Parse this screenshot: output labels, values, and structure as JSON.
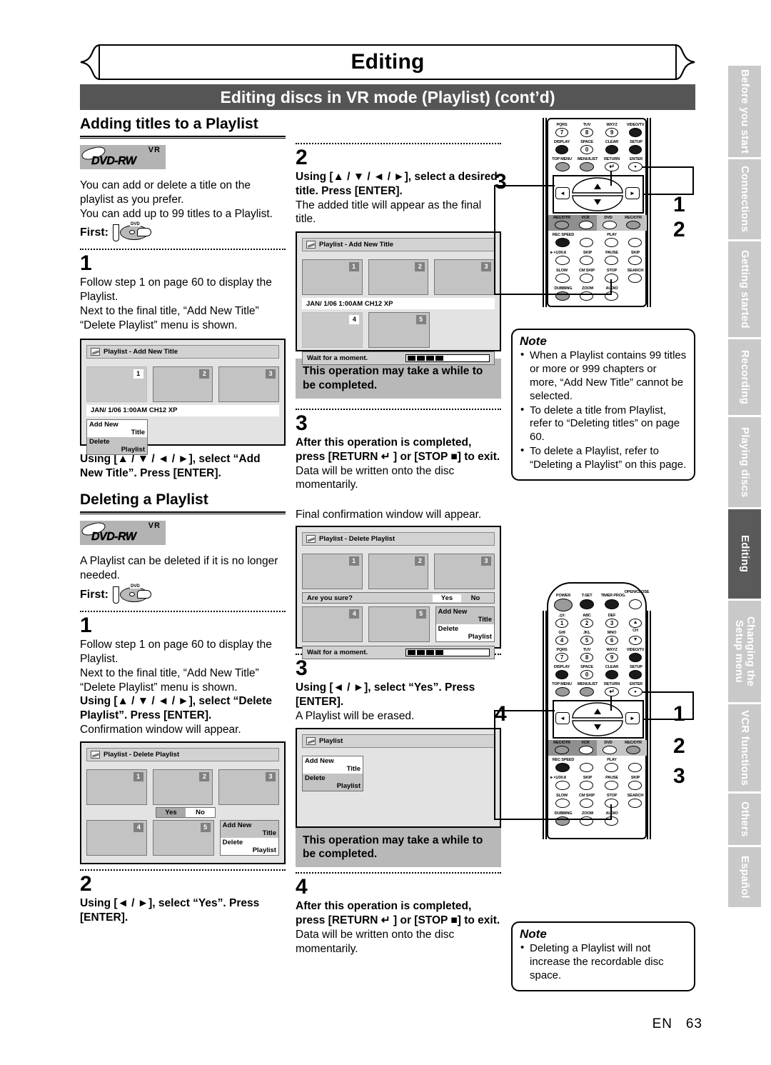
{
  "header": {
    "chapter_title": "Editing",
    "section_bar": "Editing discs in VR mode (Playlist) (cont’d)"
  },
  "sections": {
    "adding": {
      "heading": "Adding titles to a Playlist",
      "disc_logo": {
        "vr": "VR",
        "name": "DVD-RW"
      },
      "intro": "You can add or delete a title on the playlist as you prefer.\nYou can add up to 99 titles to a Playlist.",
      "first_label": "First:",
      "steps": [
        {
          "num": "1",
          "body": "Follow step 1 on page 60 to display the Playlist.\nNext to the final title, “Add New Title” “Delete Playlist” menu is shown.",
          "bold_after": "Using [▲ / ▼ / ◄ / ►], select “Add New Title”. Press [ENTER]."
        },
        {
          "num": "2",
          "bold": "Using [▲ / ▼ / ◄ / ►], select a desired title. Press [ENTER].",
          "body": "The added title will appear as the final title.",
          "gray_note": "This operation may take a while to be completed."
        },
        {
          "num": "3",
          "bold": "After this operation is completed, press [RETURN ↵ ] or [STOP ■] to exit.",
          "body": "Data will be written onto the disc momentarily."
        }
      ]
    },
    "deleting": {
      "heading": "Deleting a Playlist",
      "disc_logo": {
        "vr": "VR",
        "name": "DVD-RW"
      },
      "intro": "A Playlist can be deleted if it is no longer needed.",
      "first_label": "First:",
      "steps": [
        {
          "num": "1",
          "body": "Follow step 1 on page 60 to display the Playlist.\nNext to the final title, “Add New Title” “Delete Playlist” menu is shown.",
          "bold_after": "Using [▲ / ▼ / ◄ / ►], select “Delete Playlist”. Press [ENTER].",
          "tail": "Confirmation window will appear."
        },
        {
          "num": "2",
          "bold": "Using [◄ / ►], select “Yes”. Press [ENTER].",
          "body": "Final confirmation window will appear."
        },
        {
          "num": "3",
          "bold": "Using [◄ / ►], select “Yes”. Press [ENTER].",
          "body": "A Playlist will be erased.",
          "gray_note": "This operation may take a while to be completed."
        },
        {
          "num": "4",
          "bold": "After this operation is completed, press [RETURN ↵ ] or [STOP ■] to exit.",
          "body": "Data will be written onto the disc momentarily."
        }
      ]
    }
  },
  "screens": {
    "add_new_title_1": {
      "title": "Playlist - Add New Title",
      "thumbs_row1": [
        "1",
        "2",
        "3"
      ],
      "selected": "1",
      "info": "JAN/ 1/06 1:00AM CH12 XP",
      "menu": {
        "item1_a": "Add New",
        "item1_b": "Title",
        "item2_a": "Delete",
        "item2_b": "Playlist",
        "highlight": "item1"
      }
    },
    "add_new_title_2": {
      "title": "Playlist - Add New Title",
      "thumbs_row1": [
        "1",
        "2",
        "3"
      ],
      "thumbs_row2": [
        "4",
        "5"
      ],
      "selected": "4",
      "info": "JAN/ 1/06 1:00AM CH12 XP",
      "wait": "Wait for a moment."
    },
    "delete_playlist_1": {
      "title": "Playlist - Delete Playlist",
      "thumbs_row1": [
        "1",
        "2",
        "3"
      ],
      "thumbs_row2": [
        "4",
        "5"
      ],
      "yes": "Yes",
      "no": "No",
      "highlight": "No",
      "menu": {
        "item1_a": "Add New",
        "item1_b": "Title",
        "item2_a": "Delete",
        "item2_b": "Playlist",
        "highlight": "item2"
      }
    },
    "delete_playlist_2": {
      "title": "Playlist - Delete Playlist",
      "thumbs_row1": [
        "1",
        "2",
        "3"
      ],
      "thumbs_row2": [
        "4",
        "5"
      ],
      "prompt": "Are you sure?",
      "yes": "Yes",
      "no": "No",
      "highlight": "Yes",
      "menu": {
        "item1_a": "Add New",
        "item1_b": "Title",
        "item2_a": "Delete",
        "item2_b": "Playlist",
        "highlight": "item2"
      },
      "wait": "Wait for a moment."
    },
    "playlist_empty": {
      "title": "Playlist",
      "menu": {
        "item1_a": "Add New",
        "item1_b": "Title",
        "item2_a": "Delete",
        "item2_b": "Playlist",
        "highlight": "item1"
      }
    }
  },
  "notes": {
    "top": {
      "label": "Note",
      "items": [
        "When a Playlist contains 99 titles or more or 999 chapters or more, “Add New Title” cannot be selected.",
        "To delete a title from Playlist, refer to “Deleting titles” on page 60.",
        "To delete a Playlist, refer to “Deleting a Playlist” on this page."
      ]
    },
    "bottom": {
      "label": "Note",
      "items": [
        "Deleting a Playlist will not increase the recordable disc space."
      ]
    }
  },
  "remote_top": {
    "callouts": [
      "3",
      "1",
      "2"
    ],
    "rows": [
      [
        "PQRS",
        "TUV",
        "WXYZ",
        "VIDEO/TV"
      ],
      [
        "DISPLAY",
        "SPACE",
        "CLEAR",
        "SETUP"
      ],
      [
        "TOP MENU",
        "MENU/LIST",
        "RETURN",
        "ENTER"
      ]
    ],
    "digits": [
      "7",
      "8",
      "9",
      "",
      "",
      "0",
      "",
      ""
    ],
    "mode_row": [
      "REC/OTR",
      "VCR",
      "DVD",
      "REC/OTR"
    ],
    "transport": [
      [
        "REC SPEED",
        "",
        "PLAY",
        ""
      ],
      [
        "►×1/30.8",
        "SKIP",
        "PAUSE",
        "SKIP"
      ],
      [
        "SLOW",
        "CM SKIP",
        "STOP",
        "SEARCH"
      ],
      [
        "DUBBING",
        "ZOOM",
        "AUDIO",
        ""
      ]
    ]
  },
  "remote_bottom": {
    "callouts": [
      "4",
      "1",
      "2",
      "3"
    ],
    "rows": [
      [
        "POWER",
        "T-SET",
        "TIMER PROG.",
        "OPEN/CLOSE"
      ],
      [
        ".@/:",
        "ABC",
        "DEF",
        "CH"
      ],
      [
        "GHI",
        "JKL",
        "MNO",
        ""
      ],
      [
        "PQRS",
        "TUV",
        "WXYZ",
        "VIDEO/TV"
      ],
      [
        "DISPLAY",
        "SPACE",
        "CLEAR",
        "SETUP"
      ],
      [
        "TOP MENU",
        "MENU/LIST",
        "RETURN",
        "ENTER"
      ]
    ],
    "digits": [
      "1",
      "2",
      "3",
      "4",
      "5",
      "6",
      "7",
      "8",
      "9",
      "0"
    ],
    "mode_row": [
      "REC/OTR",
      "VCR",
      "DVD",
      "REC/OTR"
    ],
    "transport": [
      [
        "REC SPEED",
        "",
        "PLAY",
        ""
      ],
      [
        "►×1/30.8",
        "SKIP",
        "PAUSE",
        "SKIP"
      ],
      [
        "SLOW",
        "CM SKIP",
        "STOP",
        "SEARCH"
      ],
      [
        "DUBBING",
        "ZOOM",
        "AUDIO",
        ""
      ]
    ]
  },
  "tabs": [
    {
      "label": "Before you start",
      "active": false
    },
    {
      "label": "Connections",
      "active": false
    },
    {
      "label": "Getting started",
      "active": false
    },
    {
      "label": "Recording",
      "active": false
    },
    {
      "label": "Playing discs",
      "active": false
    },
    {
      "label": "Editing",
      "active": true
    },
    {
      "label": "Changing the\nSetup menu",
      "active": false
    },
    {
      "label": "VCR functions",
      "active": false
    },
    {
      "label": "Others",
      "active": false
    },
    {
      "label": "Español",
      "active": false
    }
  ],
  "footer": {
    "lang": "EN",
    "page": "63"
  }
}
